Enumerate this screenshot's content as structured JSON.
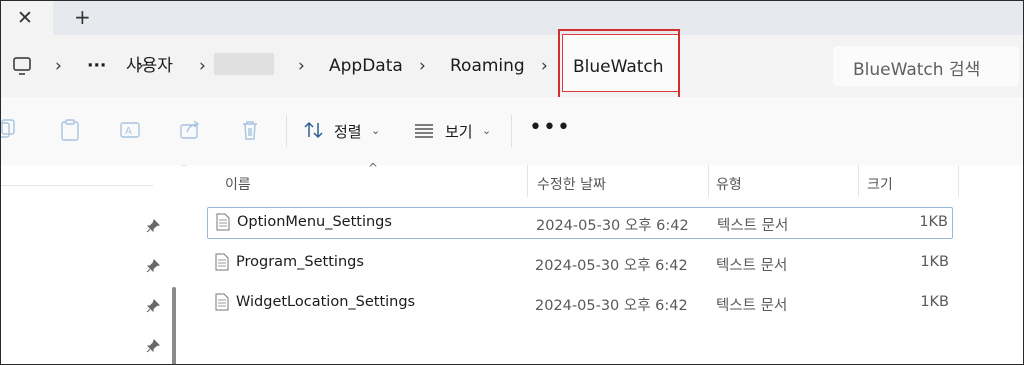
{
  "tabs": {
    "close_glyph": "✕",
    "new_glyph": "+"
  },
  "breadcrumb": {
    "items": [
      "사용자",
      "AppData",
      "Roaming"
    ],
    "ellipsis": "···",
    "current": "BlueWatch",
    "highlight_color": "#d22f2f"
  },
  "search": {
    "placeholder": "BlueWatch 검색"
  },
  "commandbar": {
    "sort_label": "정렬",
    "view_label": "보기",
    "more_label": "•••"
  },
  "columns": {
    "name": "이름",
    "modified": "수정한 날짜",
    "type": "유형",
    "size": "크기"
  },
  "files": [
    {
      "name": "OptionMenu_Settings",
      "modified": "2024-05-30 오후 6:42",
      "type": "텍스트 문서",
      "size": "1KB",
      "selected": true
    },
    {
      "name": "Program_Settings",
      "modified": "2024-05-30 오후 6:42",
      "type": "텍스트 문서",
      "size": "1KB",
      "selected": false
    },
    {
      "name": "WidgetLocation_Settings",
      "modified": "2024-05-30 오후 6:42",
      "type": "텍스트 문서",
      "size": "1KB",
      "selected": false
    }
  ]
}
